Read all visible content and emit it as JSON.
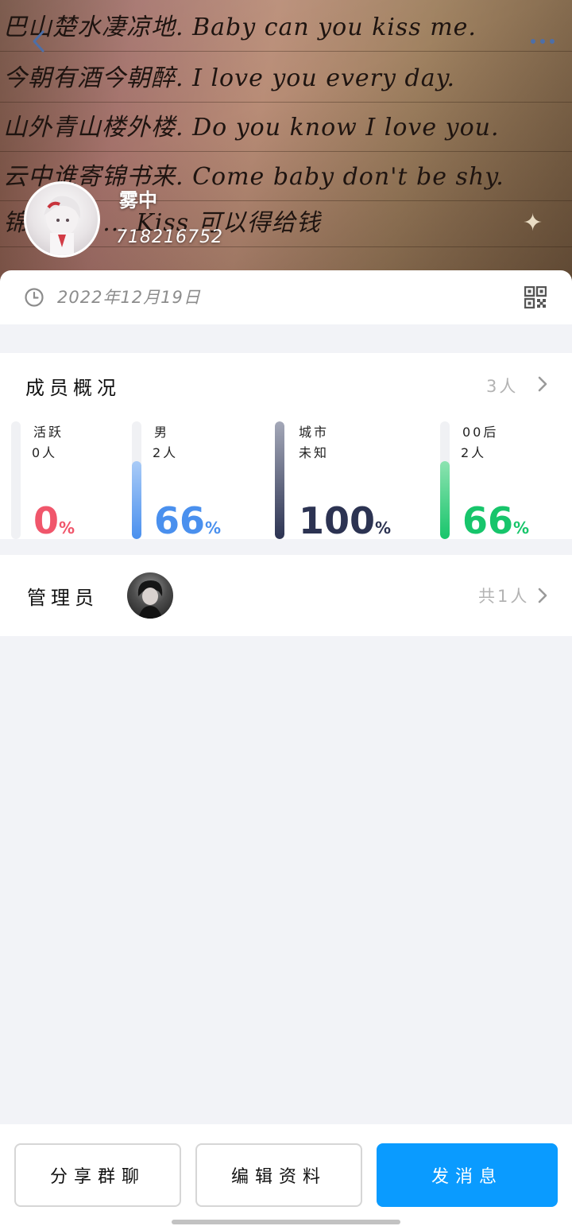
{
  "banner": {
    "lines": [
      "巴山楚水凄凉地. Baby can you kiss me.",
      "今朝有酒今朝醉. I love you every day.",
      "山外青山楼外楼. Do you know I love you.",
      "云中谁寄锦书来. Come baby don't be shy.",
      "锦 ... 十 ... Kiss 可以得给钱"
    ],
    "star": "✦"
  },
  "group": {
    "name": "雾中",
    "id": "718216752"
  },
  "date": {
    "text": "2022年12月19日"
  },
  "members": {
    "title": "成员概况",
    "count": "3人",
    "stats": [
      {
        "label": "活跃",
        "sub": "0人",
        "value": "0",
        "unit": "%",
        "percent": 0,
        "color": "#f0566b",
        "fill_from": "#f0566b",
        "fill_to": "#f0566b"
      },
      {
        "label": "男",
        "sub": "2人",
        "value": "66",
        "unit": "%",
        "percent": 66,
        "color": "#4a90ee",
        "fill_from": "#a9cbf7",
        "fill_to": "#4a90ee"
      },
      {
        "label": "城市",
        "sub": "未知",
        "value": "100",
        "unit": "%",
        "percent": 100,
        "color": "#2c3352",
        "fill_from": "#a4a8b8",
        "fill_to": "#2c3352"
      },
      {
        "label": "00后",
        "sub": "2人",
        "value": "66",
        "unit": "%",
        "percent": 66,
        "color": "#17c56b",
        "fill_from": "#8de3b1",
        "fill_to": "#17c56b"
      }
    ]
  },
  "admin": {
    "title": "管理员",
    "count": "共1人"
  },
  "buttons": {
    "share": "分享群聊",
    "edit": "编辑资料",
    "message": "发消息"
  },
  "colors": {
    "primary": "#0a9bff",
    "background": "#f2f3f7"
  }
}
